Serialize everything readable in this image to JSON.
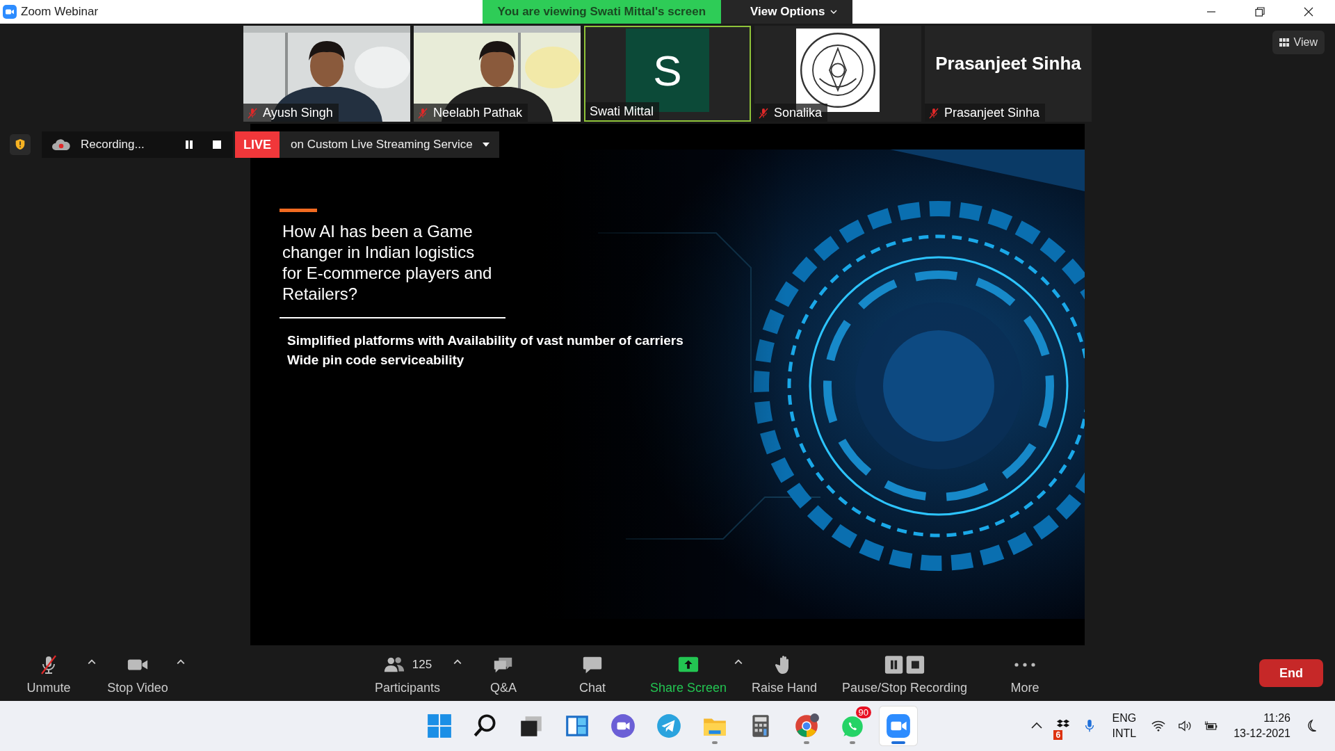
{
  "window": {
    "title": "Zoom Webinar"
  },
  "banner": {
    "text": "You are viewing Swati Mittal's screen",
    "options": "View Options"
  },
  "participants": [
    {
      "name": "Ayush Singh",
      "kind": "video",
      "muted": true,
      "selected": false
    },
    {
      "name": "Neelabh Pathak",
      "kind": "video",
      "muted": true,
      "selected": false
    },
    {
      "name": "Swati Mittal",
      "kind": "avatar",
      "initial": "S",
      "muted": false,
      "selected": true
    },
    {
      "name": "Sonalika",
      "kind": "logo",
      "muted": true,
      "selected": false
    },
    {
      "name": "Prasanjeet Sinha",
      "kind": "name",
      "display": "Prasanjeet Sinha",
      "muted": true,
      "selected": false
    }
  ],
  "view_button": "View",
  "recording": {
    "label": "Recording...",
    "live": "LIVE",
    "stream": "on Custom Live Streaming Service"
  },
  "slide": {
    "title": "How AI has been a Game\nchanger in Indian logistics\nfor E-commerce players and\nRetailers?",
    "points": [
      "Simplified platforms with Availability of vast number of carriers",
      "Wide pin code serviceability"
    ]
  },
  "toolbar": [
    {
      "kind": "mic",
      "label": "Unmute",
      "muted": true,
      "caret": true,
      "highlighted": false
    },
    {
      "kind": "video",
      "label": "Stop Video",
      "caret": true,
      "highlighted": false
    },
    {
      "kind": "participants",
      "label": "Participants",
      "count": "125",
      "caret": true,
      "highlighted": false
    },
    {
      "kind": "qa",
      "label": "Q&A",
      "caret": false,
      "highlighted": false
    },
    {
      "kind": "chat",
      "label": "Chat",
      "caret": false,
      "highlighted": false
    },
    {
      "kind": "share",
      "label": "Share Screen",
      "caret": true,
      "highlighted": true
    },
    {
      "kind": "hand",
      "label": "Raise Hand",
      "caret": false,
      "highlighted": false
    },
    {
      "kind": "record",
      "label": "Pause/Stop Recording",
      "caret": false,
      "highlighted": false
    },
    {
      "kind": "more",
      "label": "More",
      "caret": false,
      "highlighted": false
    }
  ],
  "end_button": "End",
  "taskbar": {
    "apps": [
      {
        "kind": "start",
        "running": false,
        "selected": false
      },
      {
        "kind": "search",
        "running": false,
        "selected": false
      },
      {
        "kind": "taskview",
        "running": false,
        "selected": false
      },
      {
        "kind": "widgets",
        "running": false,
        "selected": false
      },
      {
        "kind": "meet",
        "running": false,
        "selected": false
      },
      {
        "kind": "telegram",
        "running": false,
        "selected": false
      },
      {
        "kind": "folder",
        "running": true,
        "selected": false
      },
      {
        "kind": "calculator",
        "running": false,
        "selected": false
      },
      {
        "kind": "chrome",
        "running": true,
        "selected": false
      },
      {
        "kind": "whatsapp",
        "running": true,
        "selected": false,
        "badge": "90"
      },
      {
        "kind": "zoom",
        "running": true,
        "selected": true
      }
    ],
    "tray": {
      "badge": "6",
      "language": "ENG",
      "layout": "INTL",
      "time": "11:26",
      "date": "13-12-2021"
    }
  }
}
